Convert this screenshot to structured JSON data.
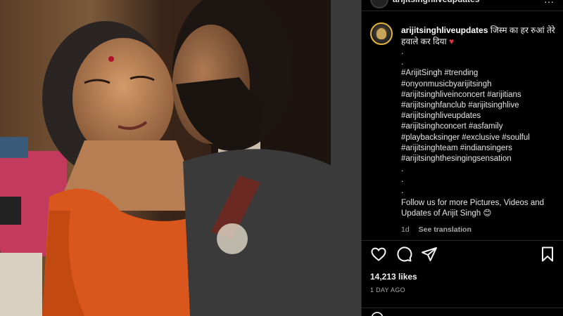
{
  "photo": {
    "description_icon": "photo"
  },
  "post": {
    "username": "arijitsinghliveupdates",
    "caption_hindi": "जिस्म का हर रुआं तेरे हवाले कर दिया",
    "heart": "♥",
    "caption_lines": [
      ".",
      ".",
      "#ArijitSingh #trending",
      "#onyonmusicbyarijitsingh",
      "#arijitsinghliveinconcert #arijitians",
      "#arijitsinghfanclub #arijitsinghlive",
      "#arijitsinghliveupdates",
      "#arijitsinghconcert #asfamily",
      "#playbacksinger #exclusive #soulful",
      "#arijitsinghteam #indiansingers",
      "#arijitsinghthesingingsensation",
      ".",
      ".",
      "."
    ],
    "follow_text": "Follow us for more Pictures, Videos and Updates of Arijit Singh 😊",
    "age": "1d",
    "see_translation": "See translation",
    "likes": "14,213 likes",
    "date": "1 DAY AGO"
  },
  "icons": {
    "like": "heart-icon",
    "comment": "comment-icon",
    "share": "share-icon",
    "save": "bookmark-icon",
    "more": "more-icon"
  },
  "colors": {
    "background": "#000000",
    "heart": "#ed2d3c",
    "muted": "#a8a8a8",
    "avatar_ring": "#e2b33c"
  }
}
